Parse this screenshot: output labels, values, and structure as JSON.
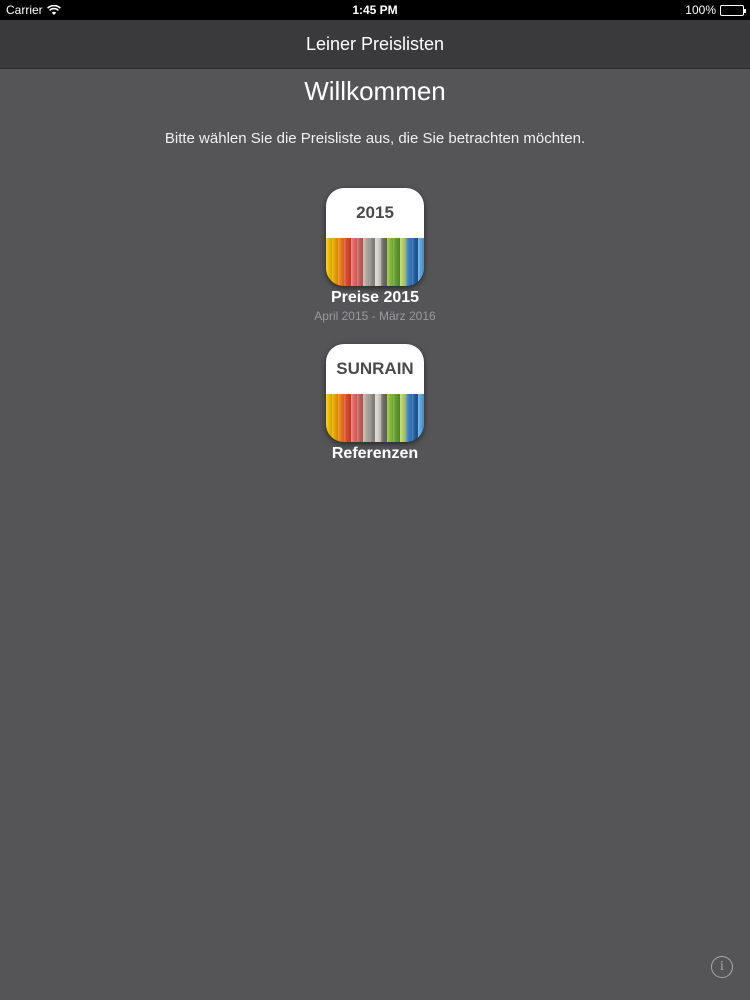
{
  "status_bar": {
    "carrier": "Carrier",
    "time": "1:45 PM",
    "battery": "100%"
  },
  "navbar": {
    "title": "Leiner Preislisten"
  },
  "main": {
    "heading": "Willkommen",
    "subtitle": "Bitte wählen Sie die Preisliste aus, die Sie betrachten möchten."
  },
  "tiles": [
    {
      "icon_text": "2015",
      "label": "Preise 2015",
      "sublabel": "April 2015 - März 2016"
    },
    {
      "icon_text": "SUNRAIN",
      "label": "Referenzen",
      "sublabel": ""
    }
  ],
  "stripe_colors": [
    "#f2c200",
    "#e8a400",
    "#f07a1a",
    "#d9472e",
    "#e86a6a",
    "#c65f59",
    "#b8b0a6",
    "#8e8a84",
    "#d8d4cc",
    "#6f6a64",
    "#8cbf3a",
    "#5e9c2e",
    "#b7d06a",
    "#3a7fc4",
    "#1f5e9e",
    "#5aa4e0"
  ],
  "info_icon": "info-icon"
}
